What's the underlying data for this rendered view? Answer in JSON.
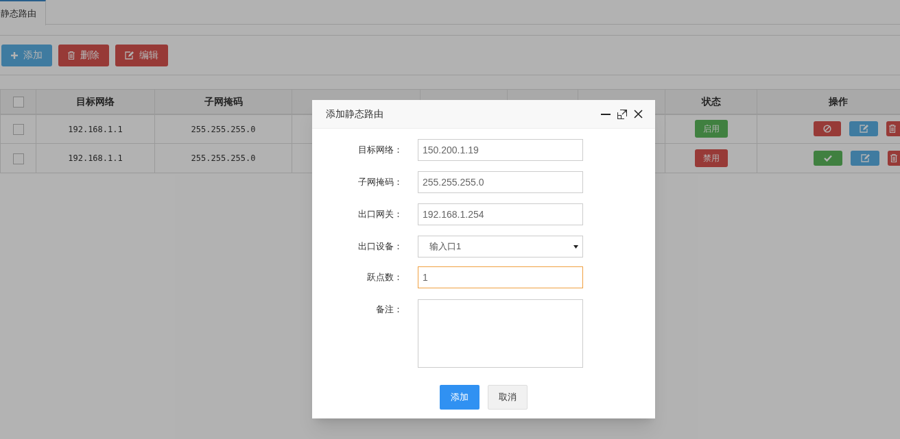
{
  "tabs": [
    {
      "label": "静态路由",
      "selected": true
    }
  ],
  "toolbar": [
    {
      "kind": "add",
      "label": "添加"
    },
    {
      "kind": "delete",
      "label": "删除"
    },
    {
      "kind": "edit",
      "label": "编辑"
    }
  ],
  "table": {
    "columns": [
      {
        "kind": "check",
        "checked": false
      },
      {
        "label": "目标网络"
      },
      {
        "label": "子网掩码"
      },
      {},
      {},
      {},
      {},
      {
        "label": "状态"
      },
      {
        "label": "操作"
      }
    ],
    "rows": [
      {
        "checked": false,
        "network": "192.168.1.1",
        "mask": "255.255.255.0",
        "enabled": true,
        "status": "启用"
      },
      {
        "checked": false,
        "network": "192.168.1.1",
        "mask": "255.255.255.0",
        "enabled": false,
        "status": "禁用"
      }
    ]
  },
  "dialog": {
    "title": "添加静态路由",
    "fields": [
      {
        "kind": "text",
        "label": "目标网络：",
        "value": "150.200.1.19",
        "focused": false
      },
      {
        "kind": "text",
        "label": "子网掩码：",
        "value": "255.255.255.0",
        "focused": false
      },
      {
        "kind": "text",
        "label": "出口网关：",
        "value": "192.168.1.254",
        "focused": false
      },
      {
        "kind": "select",
        "label": "出口设备：",
        "value": "输入口1",
        "focused": false
      },
      {
        "kind": "text",
        "label": "跃点数：",
        "value": "1",
        "focused": true
      },
      {
        "kind": "textarea",
        "label": "备注：",
        "focused": false
      }
    ],
    "buttons": [
      {
        "kind": "primary",
        "label": "添加"
      },
      {
        "kind": "default",
        "label": "取消"
      }
    ]
  }
}
